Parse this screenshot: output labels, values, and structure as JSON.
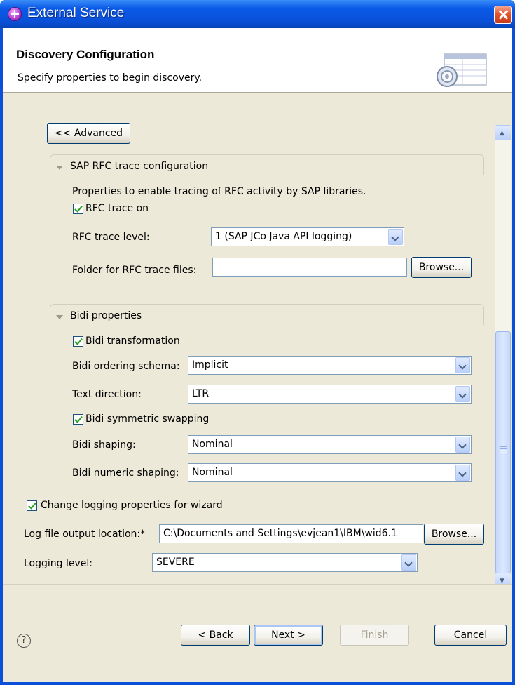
{
  "window": {
    "title": "External Service"
  },
  "header": {
    "title": "Discovery Configuration",
    "description": "Specify properties to begin discovery."
  },
  "advanced_button": "<< Advanced",
  "rfc_trace": {
    "heading": "SAP RFC trace configuration",
    "description": "Properties to enable tracing of RFC activity by SAP libraries.",
    "trace_on_label": "RFC trace on",
    "trace_on_checked": true,
    "level_label": "RFC trace level:",
    "level_value": "1 (SAP JCo Java API logging)",
    "folder_label": "Folder for RFC trace files:",
    "folder_value": "",
    "browse_label": "Browse..."
  },
  "bidi": {
    "heading": "Bidi properties",
    "transformation_label": "Bidi transformation",
    "transformation_checked": true,
    "ordering_label": "Bidi ordering schema:",
    "ordering_value": "Implicit",
    "direction_label": "Text direction:",
    "direction_value": "LTR",
    "symmetric_label": "Bidi symmetric swapping",
    "symmetric_checked": true,
    "shaping_label": "Bidi shaping:",
    "shaping_value": "Nominal",
    "numeric_label": "Bidi numeric shaping:",
    "numeric_value": "Nominal"
  },
  "logging": {
    "change_label": "Change logging properties for wizard",
    "change_checked": true,
    "location_label": "Log file output location:*",
    "location_value": "C:\\Documents and Settings\\evjean1\\IBM\\wid6.1",
    "browse_label": "Browse...",
    "level_label": "Logging level:",
    "level_value": "SEVERE"
  },
  "footer": {
    "help_glyph": "?",
    "back_label": "< Back",
    "next_label": "Next >",
    "finish_label": "Finish",
    "cancel_label": "Cancel"
  },
  "colors": {
    "title_bar": "#0a50d8",
    "dialog_bg": "#ece9d8",
    "check_mark": "#21a121"
  }
}
